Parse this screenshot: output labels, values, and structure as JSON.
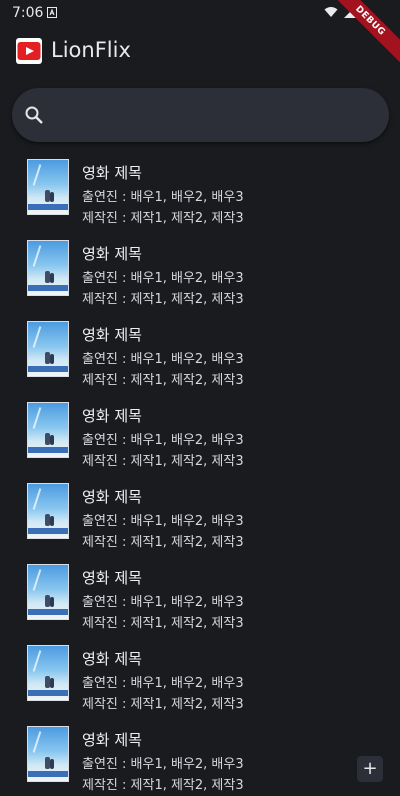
{
  "status_bar": {
    "time": "7:06",
    "debug_label": "DEBUG"
  },
  "app_bar": {
    "title": "LionFlix",
    "logo_icon": "play-logo-icon",
    "logo_color": "#e31f24"
  },
  "search": {
    "placeholder": "",
    "value": ""
  },
  "movies": [
    {
      "title": "영화 제목",
      "cast": "출연진 : 배우1, 배우2, 배우3",
      "crew": "제작진 : 제작1, 제작2, 제작3"
    },
    {
      "title": "영화 제목",
      "cast": "출연진 : 배우1, 배우2, 배우3",
      "crew": "제작진 : 제작1, 제작2, 제작3"
    },
    {
      "title": "영화 제목",
      "cast": "출연진 : 배우1, 배우2, 배우3",
      "crew": "제작진 : 제작1, 제작2, 제작3"
    },
    {
      "title": "영화 제목",
      "cast": "출연진 : 배우1, 배우2, 배우3",
      "crew": "제작진 : 제작1, 제작2, 제작3"
    },
    {
      "title": "영화 제목",
      "cast": "출연진 : 배우1, 배우2, 배우3",
      "crew": "제작진 : 제작1, 제작2, 제작3"
    },
    {
      "title": "영화 제목",
      "cast": "출연진 : 배우1, 배우2, 배우3",
      "crew": "제작진 : 제작1, 제작2, 제작3"
    },
    {
      "title": "영화 제목",
      "cast": "출연진 : 배우1, 배우2, 배우3",
      "crew": "제작진 : 제작1, 제작2, 제작3"
    },
    {
      "title": "영화 제목",
      "cast": "출연진 : 배우1, 배우2, 배우3",
      "crew": "제작진 : 제작1, 제작2, 제작3"
    }
  ],
  "fab": {
    "label": "+"
  }
}
